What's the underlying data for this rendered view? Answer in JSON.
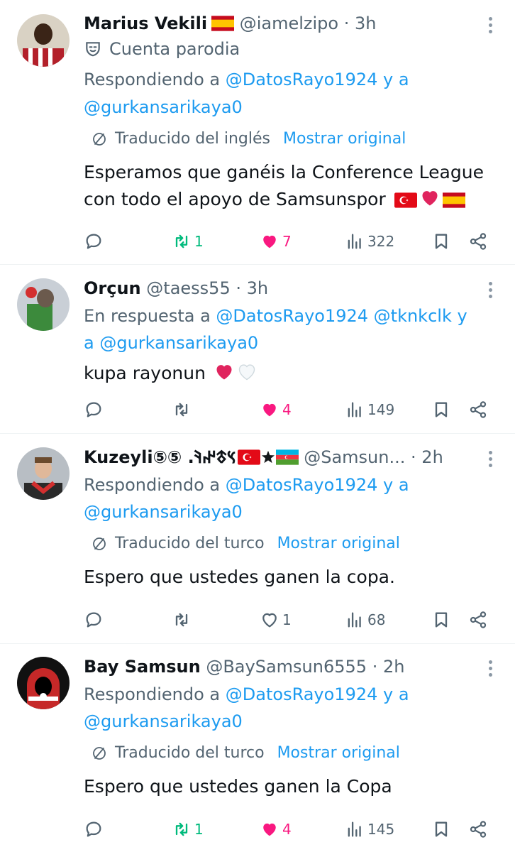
{
  "colors": {
    "accent": "#1d9bf0",
    "muted": "#536471",
    "retweet_active": "#00ba7c",
    "like_active": "#f91880"
  },
  "tweets": [
    {
      "name": "Marius Vekili",
      "name_flag": "spain-flag",
      "handle": "@iamelzipo",
      "separator": "·",
      "time": "3h",
      "parody_label": "Cuenta parodia",
      "reply_prefix": "Respondiendo a",
      "reply_line1_mention": "@DatosRayo1924",
      "reply_line1_suffix": "y a",
      "reply_line2_mention": "@gurkansarikaya0",
      "translated_label": "Traducido del inglés",
      "show_original": "Mostrar original",
      "text_line1": "Esperamos que ganéis la Conference League",
      "text_line2": "con todo el apoyo de Samsunspor",
      "text_emojis": [
        "turkey-flag",
        "red-heart",
        "spain-flag"
      ],
      "replies": "",
      "retweets": "1",
      "retweeted": true,
      "likes": "7",
      "liked": true,
      "views": "322"
    },
    {
      "name": "Orçun",
      "handle": "@taess55",
      "separator": "·",
      "time": "3h",
      "reply_prefix": "En respuesta a",
      "reply_line1_mentions": "@DatosRayo1924 @tknkclk",
      "reply_line1_suffix": "y",
      "reply_line2_prefix": "a",
      "reply_line2_mention": "@gurkansarikaya0",
      "text_line1": "kupa rayonun",
      "text_emojis": [
        "red-heart",
        "white-heart"
      ],
      "replies": "",
      "retweets": "",
      "retweeted": false,
      "likes": "4",
      "liked": true,
      "views": "149"
    },
    {
      "name": "Kuzeyli⑤⑤ .𐰽𐱃𐰤𐰚",
      "name_emojis": [
        "turkey-flag",
        "star",
        "azerbaijan-flag"
      ],
      "handle": "@Samsun...",
      "separator": "·",
      "time": "2h",
      "reply_prefix": "Respondiendo a",
      "reply_line1_mention": "@DatosRayo1924",
      "reply_line1_suffix": "y a",
      "reply_line2_mention": "@gurkansarikaya0",
      "translated_label": "Traducido del turco",
      "show_original": "Mostrar original",
      "text_line1": "Espero que ustedes ganen la copa.",
      "replies": "",
      "retweets": "",
      "retweeted": false,
      "likes": "1",
      "liked": false,
      "views": "68"
    },
    {
      "name": "Bay Samsun",
      "handle": "@BaySamsun6555",
      "separator": "·",
      "time": "2h",
      "reply_prefix": "Respondiendo a",
      "reply_line1_mention": "@DatosRayo1924",
      "reply_line1_suffix": "y a",
      "reply_line2_mention": "@gurkansarikaya0",
      "translated_label": "Traducido del turco",
      "show_original": "Mostrar original",
      "text_line1": "Espero que ustedes ganen la Copa",
      "replies": "",
      "retweets": "1",
      "retweeted": true,
      "likes": "4",
      "liked": true,
      "views": "145"
    }
  ]
}
